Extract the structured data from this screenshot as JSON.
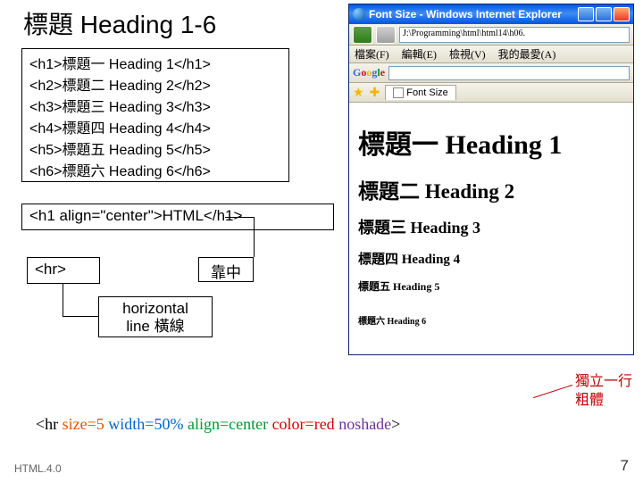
{
  "title": "標題 Heading 1-6",
  "code_block": {
    "l1": "<h1>標題一 Heading 1</h1>",
    "l2": "<h2>標題二 Heading 2</h2>",
    "l3": "<h3>標題三 Heading 3</h3>",
    "l4": "<h4>標題四 Heading 4</h4>",
    "l5": "<h5>標題五 Heading 5</h5>",
    "l6": "<h6>標題六 Heading 6</h6>"
  },
  "align_example": "<h1 align=\"center\">HTML</h1>",
  "align_label": "靠中",
  "hr_tag": "<hr>",
  "hr_explain_l1": "horizontal",
  "hr_explain_l2": "line 橫線",
  "annot_l1": "獨立一行",
  "annot_l2": "粗體",
  "hr_example": {
    "open": "<hr ",
    "size": "size=5",
    "width": " width=50%",
    "align": " align=center",
    "color": " color=red",
    "noshade": " noshade",
    "close": ">"
  },
  "ie": {
    "title": "Font Size - Windows Internet Explorer",
    "address": "J:\\Programming\\html\\html14\\h06.",
    "menu": {
      "file": "檔案(F)",
      "edit": "編輯(E)",
      "view": "檢視(V)",
      "fav": "我的最愛(A)"
    },
    "tab": "Font Size",
    "h1": "標題一 Heading 1",
    "h2": "標題二 Heading 2",
    "h3": "標題三 Heading 3",
    "h4": "標題四 Heading 4",
    "h5": "標題五 Heading 5",
    "h6": "標題六 Heading 6"
  },
  "footer_left": "HTML.4.0",
  "footer_right": "7"
}
